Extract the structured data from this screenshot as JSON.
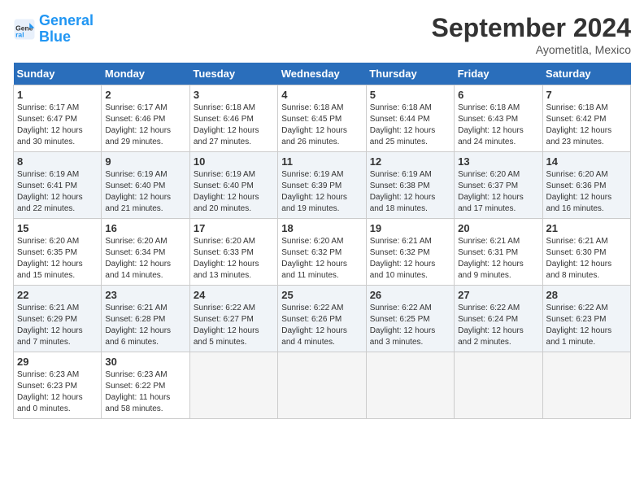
{
  "logo": {
    "line1": "General",
    "line2": "Blue"
  },
  "title": "September 2024",
  "subtitle": "Ayometitla, Mexico",
  "days_of_week": [
    "Sunday",
    "Monday",
    "Tuesday",
    "Wednesday",
    "Thursday",
    "Friday",
    "Saturday"
  ],
  "weeks": [
    [
      {
        "day": "1",
        "detail": "Sunrise: 6:17 AM\nSunset: 6:47 PM\nDaylight: 12 hours\nand 30 minutes."
      },
      {
        "day": "2",
        "detail": "Sunrise: 6:17 AM\nSunset: 6:46 PM\nDaylight: 12 hours\nand 29 minutes."
      },
      {
        "day": "3",
        "detail": "Sunrise: 6:18 AM\nSunset: 6:46 PM\nDaylight: 12 hours\nand 27 minutes."
      },
      {
        "day": "4",
        "detail": "Sunrise: 6:18 AM\nSunset: 6:45 PM\nDaylight: 12 hours\nand 26 minutes."
      },
      {
        "day": "5",
        "detail": "Sunrise: 6:18 AM\nSunset: 6:44 PM\nDaylight: 12 hours\nand 25 minutes."
      },
      {
        "day": "6",
        "detail": "Sunrise: 6:18 AM\nSunset: 6:43 PM\nDaylight: 12 hours\nand 24 minutes."
      },
      {
        "day": "7",
        "detail": "Sunrise: 6:18 AM\nSunset: 6:42 PM\nDaylight: 12 hours\nand 23 minutes."
      }
    ],
    [
      {
        "day": "8",
        "detail": "Sunrise: 6:19 AM\nSunset: 6:41 PM\nDaylight: 12 hours\nand 22 minutes."
      },
      {
        "day": "9",
        "detail": "Sunrise: 6:19 AM\nSunset: 6:40 PM\nDaylight: 12 hours\nand 21 minutes."
      },
      {
        "day": "10",
        "detail": "Sunrise: 6:19 AM\nSunset: 6:40 PM\nDaylight: 12 hours\nand 20 minutes."
      },
      {
        "day": "11",
        "detail": "Sunrise: 6:19 AM\nSunset: 6:39 PM\nDaylight: 12 hours\nand 19 minutes."
      },
      {
        "day": "12",
        "detail": "Sunrise: 6:19 AM\nSunset: 6:38 PM\nDaylight: 12 hours\nand 18 minutes."
      },
      {
        "day": "13",
        "detail": "Sunrise: 6:20 AM\nSunset: 6:37 PM\nDaylight: 12 hours\nand 17 minutes."
      },
      {
        "day": "14",
        "detail": "Sunrise: 6:20 AM\nSunset: 6:36 PM\nDaylight: 12 hours\nand 16 minutes."
      }
    ],
    [
      {
        "day": "15",
        "detail": "Sunrise: 6:20 AM\nSunset: 6:35 PM\nDaylight: 12 hours\nand 15 minutes."
      },
      {
        "day": "16",
        "detail": "Sunrise: 6:20 AM\nSunset: 6:34 PM\nDaylight: 12 hours\nand 14 minutes."
      },
      {
        "day": "17",
        "detail": "Sunrise: 6:20 AM\nSunset: 6:33 PM\nDaylight: 12 hours\nand 13 minutes."
      },
      {
        "day": "18",
        "detail": "Sunrise: 6:20 AM\nSunset: 6:32 PM\nDaylight: 12 hours\nand 11 minutes."
      },
      {
        "day": "19",
        "detail": "Sunrise: 6:21 AM\nSunset: 6:32 PM\nDaylight: 12 hours\nand 10 minutes."
      },
      {
        "day": "20",
        "detail": "Sunrise: 6:21 AM\nSunset: 6:31 PM\nDaylight: 12 hours\nand 9 minutes."
      },
      {
        "day": "21",
        "detail": "Sunrise: 6:21 AM\nSunset: 6:30 PM\nDaylight: 12 hours\nand 8 minutes."
      }
    ],
    [
      {
        "day": "22",
        "detail": "Sunrise: 6:21 AM\nSunset: 6:29 PM\nDaylight: 12 hours\nand 7 minutes."
      },
      {
        "day": "23",
        "detail": "Sunrise: 6:21 AM\nSunset: 6:28 PM\nDaylight: 12 hours\nand 6 minutes."
      },
      {
        "day": "24",
        "detail": "Sunrise: 6:22 AM\nSunset: 6:27 PM\nDaylight: 12 hours\nand 5 minutes."
      },
      {
        "day": "25",
        "detail": "Sunrise: 6:22 AM\nSunset: 6:26 PM\nDaylight: 12 hours\nand 4 minutes."
      },
      {
        "day": "26",
        "detail": "Sunrise: 6:22 AM\nSunset: 6:25 PM\nDaylight: 12 hours\nand 3 minutes."
      },
      {
        "day": "27",
        "detail": "Sunrise: 6:22 AM\nSunset: 6:24 PM\nDaylight: 12 hours\nand 2 minutes."
      },
      {
        "day": "28",
        "detail": "Sunrise: 6:22 AM\nSunset: 6:23 PM\nDaylight: 12 hours\nand 1 minute."
      }
    ],
    [
      {
        "day": "29",
        "detail": "Sunrise: 6:23 AM\nSunset: 6:23 PM\nDaylight: 12 hours\nand 0 minutes."
      },
      {
        "day": "30",
        "detail": "Sunrise: 6:23 AM\nSunset: 6:22 PM\nDaylight: 11 hours\nand 58 minutes."
      },
      {
        "day": "",
        "detail": ""
      },
      {
        "day": "",
        "detail": ""
      },
      {
        "day": "",
        "detail": ""
      },
      {
        "day": "",
        "detail": ""
      },
      {
        "day": "",
        "detail": ""
      }
    ]
  ]
}
